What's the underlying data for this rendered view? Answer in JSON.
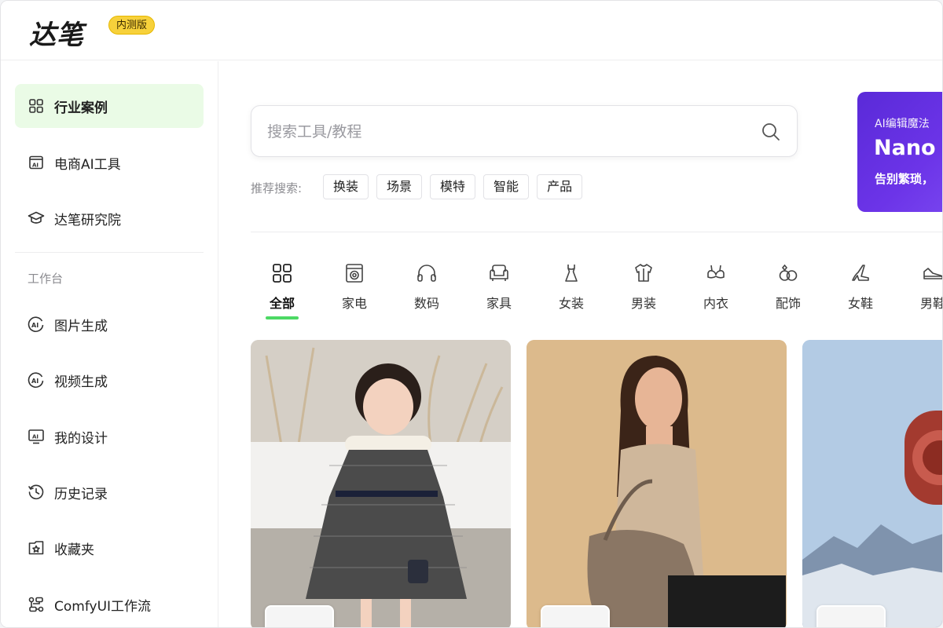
{
  "header": {
    "logo_text": "达笔",
    "badge": "内测版"
  },
  "sidebar": {
    "top_items": [
      {
        "label": "行业案例",
        "icon": "grid-icon",
        "active": true
      },
      {
        "label": "电商AI工具",
        "icon": "ai-window-icon",
        "active": false
      },
      {
        "label": "达笔研究院",
        "icon": "graduation-cap-icon",
        "active": false
      }
    ],
    "section_title": "工作台",
    "work_items": [
      {
        "label": "图片生成",
        "icon": "ai-circle-icon"
      },
      {
        "label": "视频生成",
        "icon": "ai-circle-icon"
      },
      {
        "label": "我的设计",
        "icon": "ai-monitor-icon"
      },
      {
        "label": "历史记录",
        "icon": "history-icon"
      },
      {
        "label": "收藏夹",
        "icon": "folder-star-icon"
      },
      {
        "label": "ComfyUI工作流",
        "icon": "workflow-icon"
      }
    ]
  },
  "search": {
    "placeholder": "搜索工具/教程"
  },
  "recommend": {
    "label": "推荐搜索:",
    "chips": [
      "换装",
      "场景",
      "模特",
      "智能",
      "产品"
    ]
  },
  "banner": {
    "line1": "AI编辑魔法",
    "line2": "Nano B",
    "line3": "告别繁琐，"
  },
  "categories": [
    {
      "label": "全部",
      "icon": "grid-icon",
      "active": true
    },
    {
      "label": "家电",
      "icon": "washing-machine-icon"
    },
    {
      "label": "数码",
      "icon": "headphones-icon"
    },
    {
      "label": "家具",
      "icon": "sofa-icon"
    },
    {
      "label": "女装",
      "icon": "dress-icon"
    },
    {
      "label": "男装",
      "icon": "shirt-icon"
    },
    {
      "label": "内衣",
      "icon": "bra-icon"
    },
    {
      "label": "配饰",
      "icon": "rings-icon"
    },
    {
      "label": "女鞋",
      "icon": "heel-icon"
    },
    {
      "label": "男鞋",
      "icon": "shoe-icon"
    }
  ],
  "colors": {
    "accent_green": "#4cd964",
    "active_bg": "#eafbe6",
    "badge_yellow": "#f7d13b",
    "banner_purple": "#5a2ad8"
  }
}
